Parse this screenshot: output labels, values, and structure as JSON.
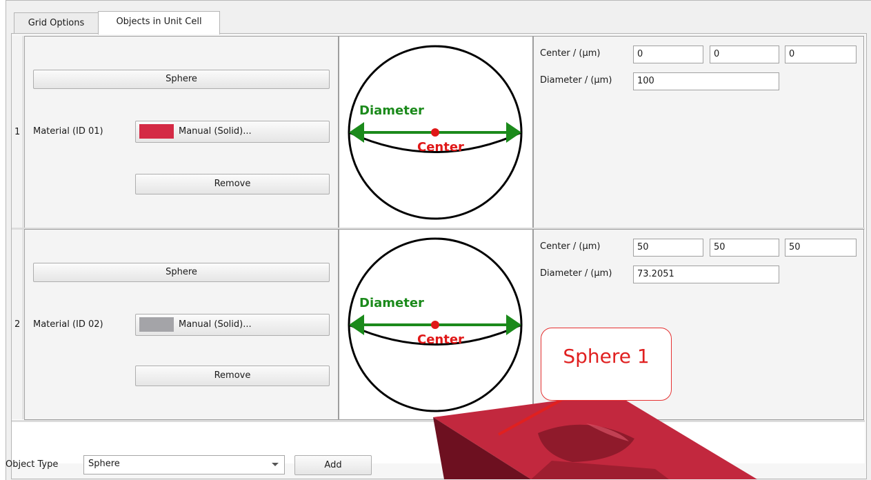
{
  "tabs": [
    {
      "label": "Grid Options"
    },
    {
      "label": "Objects in Unit Cell"
    }
  ],
  "rows": [
    {
      "number": "1",
      "shape_button": "Sphere",
      "material_label": "Material (ID 01)",
      "material_button": "Manual (Solid)...",
      "material_color": "#d42a45",
      "remove_button": "Remove",
      "diagram": {
        "diameter_label": "Diameter",
        "center_label": "Center"
      },
      "center_label": "Center / (µm)",
      "center": [
        "0",
        "0",
        "0"
      ],
      "diameter_label": "Diameter / (µm)",
      "diameter": "100"
    },
    {
      "number": "2",
      "shape_button": "Sphere",
      "material_label": "Material (ID 02)",
      "material_button": "Manual (Solid)...",
      "material_color": "#a4a4a8",
      "remove_button": "Remove",
      "diagram": {
        "diameter_label": "Diameter",
        "center_label": "Center"
      },
      "center_label": "Center / (µm)",
      "center": [
        "50",
        "50",
        "50"
      ],
      "diameter_label": "Diameter / (µm)",
      "diameter": "73.2051"
    }
  ],
  "bottom": {
    "object_type_label": "Object Type",
    "object_type_value": "Sphere",
    "add_button": "Add"
  },
  "overlay": {
    "callout_text": "Sphere 1",
    "callout_color": "#e02020",
    "solid_color": "#c2283e"
  },
  "colors": {
    "diameter": "#1b8a1b",
    "center": "#e01818"
  }
}
